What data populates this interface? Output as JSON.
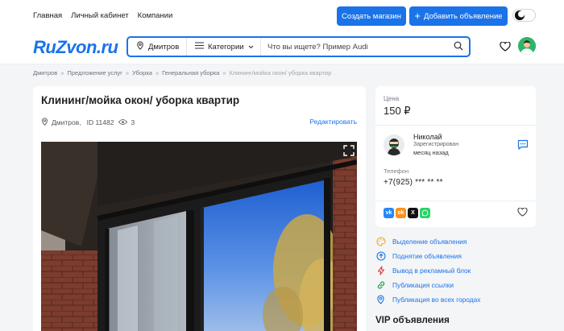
{
  "topnav": {
    "items": [
      "Главная",
      "Личный кабинет",
      "Компании"
    ]
  },
  "top_buttons": {
    "create_shop": "Создать магазин",
    "add_listing": "Добавить объявление"
  },
  "header": {
    "logo": "RuZvon.ru",
    "location": "Дмитров",
    "categories": "Категории",
    "search_placeholder": "Что вы ищете? Пример Audi"
  },
  "breadcrumb": [
    "Дмитров",
    "Предложение услуг",
    "Уборка",
    "Генеральная уборка",
    "Клининг/мойка окон/ уборка квартир"
  ],
  "listing": {
    "title": "Клининг/мойка окон/ уборка квартир",
    "city": "Дмитров,",
    "id_text": "ID 11482",
    "views": "3",
    "edit_label": "Редактировать"
  },
  "sidebar": {
    "price_label": "Цена",
    "price": "150 ₽",
    "seller_name": "Николай",
    "seller_status": "Зарегистрирован",
    "seller_since": "месяц назад",
    "phone_label": "Телефон",
    "phone": "+7(925) *** ** **",
    "share": [
      "vk",
      "ok",
      "x",
      "whatsapp"
    ]
  },
  "actions": [
    {
      "label": "Выделение объявления",
      "icon": "palette-icon",
      "color": "#f5a623"
    },
    {
      "label": "Поднятие объявления",
      "icon": "arrow-up-icon",
      "color": "#1a73e8"
    },
    {
      "label": "Вывод в рекламный блок",
      "icon": "lightning-icon",
      "color": "#e53935"
    },
    {
      "label": "Публикация ссылки",
      "icon": "link-icon",
      "color": "#2e9e4f"
    },
    {
      "label": "Публикация во всех городах",
      "icon": "location-icon",
      "color": "#1a73e8"
    }
  ],
  "vip_heading": "VIP объявления",
  "colors": {
    "accent": "#1a73e8",
    "avatar_green": "#29b26b"
  }
}
